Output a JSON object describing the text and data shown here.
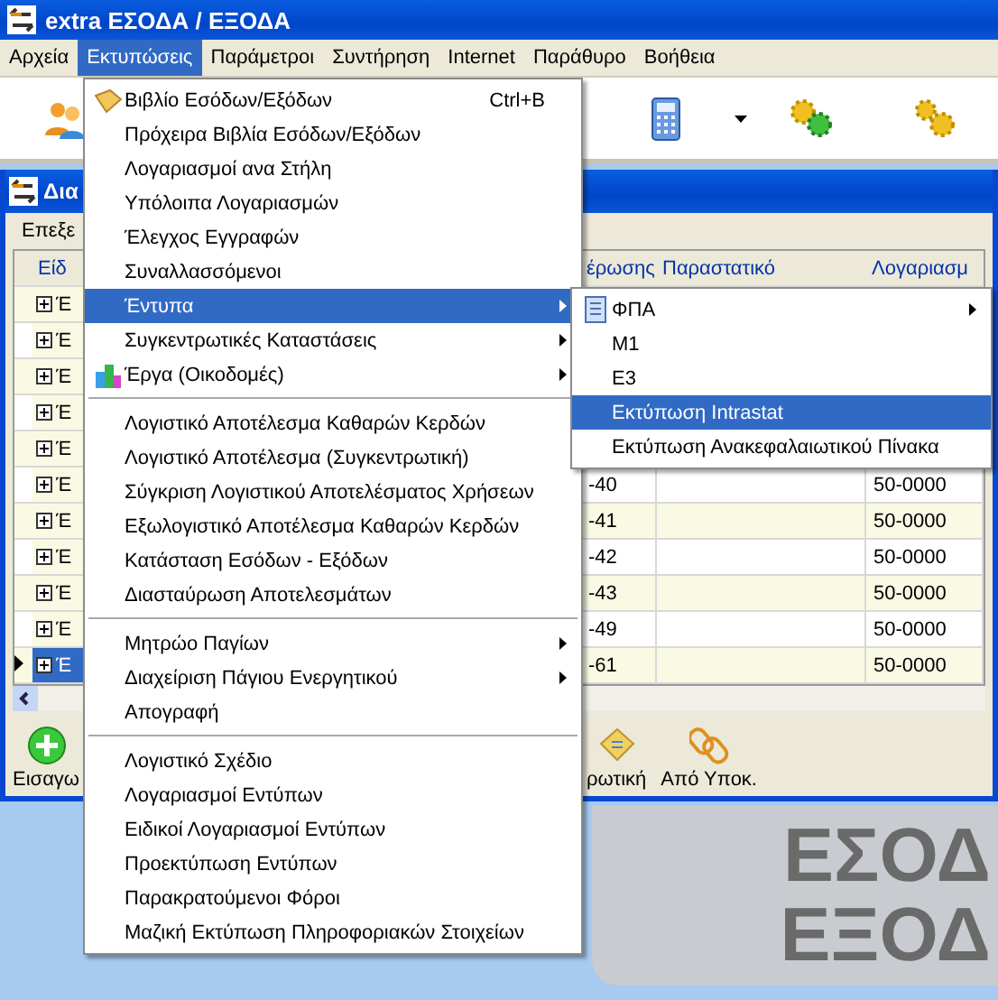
{
  "window": {
    "title": "extra ΕΣΟΔΑ / ΕΞΟΔΑ"
  },
  "menu_bar": [
    {
      "label": "Αρχεία",
      "selected": false
    },
    {
      "label": "Εκτυπώσεις",
      "selected": true
    },
    {
      "label": "Παράμετροι",
      "selected": false
    },
    {
      "label": "Συντήρηση",
      "selected": false
    },
    {
      "label": "Internet",
      "selected": false
    },
    {
      "label": "Παράθυρο",
      "selected": false
    },
    {
      "label": "Βοήθεια",
      "selected": false
    }
  ],
  "child_window": {
    "title": "Δια",
    "menu": "Επεξε",
    "table": {
      "columns": {
        "column_1": "Είδ",
        "column_3": "έρωσης",
        "column_4": "Παραστατικό",
        "column_5": "Λογαριασμ"
      },
      "rows": [
        {
          "column_1": "Έ",
          "selected": false
        },
        {
          "column_1": "Έ",
          "selected": false
        },
        {
          "column_1": "Έ",
          "selected": false
        },
        {
          "column_1": "Έ",
          "selected": false
        },
        {
          "column_1": "Έ",
          "selected": false
        },
        {
          "column_1": "Έ",
          "column_3": "-40",
          "column_5": "50-0000",
          "selected": false
        },
        {
          "column_1": "Έ",
          "column_3": "-41",
          "column_5": "50-0000",
          "selected": false
        },
        {
          "column_1": "Έ",
          "column_3": "-42",
          "column_5": "50-0000",
          "selected": false
        },
        {
          "column_1": "Έ",
          "column_3": "-43",
          "column_5": "50-0000",
          "selected": false
        },
        {
          "column_1": "Έ",
          "column_3": "-49",
          "column_5": "50-0000",
          "selected": false
        },
        {
          "column_1": "Έ",
          "column_3": "-61",
          "column_5": "50-0000",
          "selected": true
        }
      ]
    },
    "toolbar": [
      {
        "label": "Εισαγω"
      },
      {
        "label": "ρωτική"
      },
      {
        "label": "Από Υποκ."
      }
    ]
  },
  "background_text": [
    "ΕΣΟΔ",
    "ΕΞΟΔ"
  ],
  "dropdown": {
    "items": [
      {
        "kind": "item",
        "label": "Βιβλίο Εσόδων/Εξόδων",
        "shortcut": "Ctrl+B",
        "submenu": false,
        "selected": false
      },
      {
        "kind": "item",
        "label": "Πρόχειρα Βιβλία Εσόδων/Εξόδων",
        "submenu": false,
        "selected": false
      },
      {
        "kind": "item",
        "label": "Λογαριασμοί ανα Στήλη",
        "submenu": false,
        "selected": false
      },
      {
        "kind": "item",
        "label": "Υπόλοιπα Λογαριασμών",
        "submenu": false,
        "selected": false
      },
      {
        "kind": "item",
        "label": "Έλεγχος Εγγραφών",
        "submenu": false,
        "selected": false
      },
      {
        "kind": "item",
        "label": "Συναλλασσόμενοι",
        "submenu": false,
        "selected": false
      },
      {
        "kind": "item",
        "label": "Έντυπα",
        "submenu": true,
        "selected": true
      },
      {
        "kind": "item",
        "label": "Συγκεντρωτικές Καταστάσεις",
        "submenu": true,
        "selected": false
      },
      {
        "kind": "item",
        "label": "Έργα (Οικοδομές)",
        "submenu": true,
        "selected": false
      },
      {
        "kind": "separator"
      },
      {
        "kind": "item",
        "label": "Λογιστικό Αποτέλεσμα Καθαρών Κερδών",
        "submenu": false,
        "selected": false
      },
      {
        "kind": "item",
        "label": "Λογιστικό Αποτέλεσμα (Συγκεντρωτική)",
        "submenu": false,
        "selected": false
      },
      {
        "kind": "item",
        "label": "Σύγκριση Λογιστικού Αποτελέσματος Χρήσεων",
        "submenu": false,
        "selected": false
      },
      {
        "kind": "item",
        "label": "Εξωλογιστικό Αποτέλεσμα Καθαρών Κερδών",
        "submenu": false,
        "selected": false
      },
      {
        "kind": "item",
        "label": "Κατάσταση Εσόδων - Εξόδων",
        "submenu": false,
        "selected": false
      },
      {
        "kind": "item",
        "label": "Διασταύρωση Αποτελεσμάτων",
        "submenu": false,
        "selected": false
      },
      {
        "kind": "separator"
      },
      {
        "kind": "item",
        "label": "Μητρώο Παγίων",
        "submenu": true,
        "selected": false
      },
      {
        "kind": "item",
        "label": "Διαχείριση Πάγιου Ενεργητικού",
        "submenu": true,
        "selected": false
      },
      {
        "kind": "item",
        "label": "Απογραφή",
        "submenu": false,
        "selected": false
      },
      {
        "kind": "separator"
      },
      {
        "kind": "item",
        "label": "Λογιστικό Σχέδιο",
        "submenu": false,
        "selected": false
      },
      {
        "kind": "item",
        "label": "Λογαριασμοί Εντύπων",
        "submenu": false,
        "selected": false
      },
      {
        "kind": "item",
        "label": "Ειδικοί Λογαριασμοί Εντύπων",
        "submenu": false,
        "selected": false
      },
      {
        "kind": "item",
        "label": "Προεκτύπωση Εντύπων",
        "submenu": false,
        "selected": false
      },
      {
        "kind": "item",
        "label": "Παρακρατούμενοι Φόροι",
        "submenu": false,
        "selected": false
      },
      {
        "kind": "item",
        "label": "Μαζική Εκτύπωση Πληροφοριακών Στοιχείων",
        "submenu": false,
        "selected": false
      }
    ]
  },
  "submenu": {
    "items": [
      {
        "label": "ΦΠΑ",
        "submenu": true,
        "selected": false
      },
      {
        "label": "M1",
        "submenu": false,
        "selected": false
      },
      {
        "label": "E3",
        "submenu": false,
        "selected": false
      },
      {
        "label": "Εκτύπωση Intrastat",
        "submenu": false,
        "selected": true
      },
      {
        "label": "Εκτύπωση Ανακεφαλαιωτικού Πίνακα",
        "submenu": false,
        "selected": false
      }
    ]
  }
}
